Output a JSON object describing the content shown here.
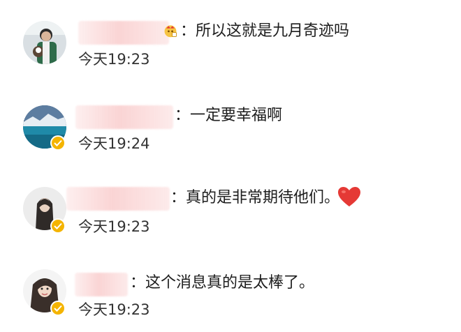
{
  "comments": [
    {
      "text": "：所以这就是九月奇迹吗",
      "time": "今天19:23",
      "verified": false
    },
    {
      "text": "：一定要幸福啊",
      "time": "今天19:24",
      "verified": true
    },
    {
      "text": "：真的是非常期待他们。",
      "time": "今天19:23",
      "verified": true,
      "emoji": "heart-emoji"
    },
    {
      "text": "：这个消息真的是太棒了。",
      "time": "今天19:23",
      "verified": true
    }
  ],
  "colors": {
    "verified_badge": "#f4b400",
    "heart": "#e53935",
    "name_redaction": "#fad2d2"
  }
}
